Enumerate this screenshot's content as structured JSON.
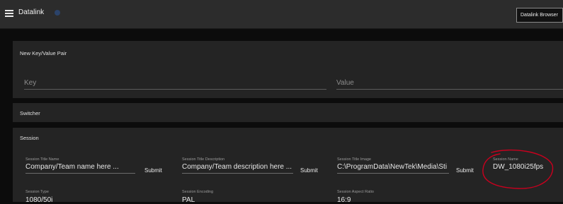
{
  "header": {
    "app_title": "Datalink",
    "browser_button": "Datalink Browser"
  },
  "key_value_panel": {
    "title": "New Key/Value Pair",
    "key_placeholder": "Key",
    "value_placeholder": "Value"
  },
  "switcher_panel": {
    "title": "Switcher"
  },
  "session_panel": {
    "title": "Session",
    "fields": [
      {
        "label": "Session Title Name",
        "value": "Company/Team name here ...",
        "submit": "Submit"
      },
      {
        "label": "Session Title Description",
        "value": "Company/Team description here ...",
        "submit": "Submit"
      },
      {
        "label": "Session Title Image",
        "value": "C:\\ProgramData\\NewTek\\Media\\Sti",
        "submit": "Submit"
      },
      {
        "label": "Session Name",
        "value": "DW_1080i25fps"
      }
    ],
    "info": [
      {
        "label": "Session Type",
        "value": "1080/50i"
      },
      {
        "label": "Session Encoding",
        "value": "PAL"
      },
      {
        "label": "Session Aspect Ratio",
        "value": "16:9"
      }
    ]
  },
  "colors": {
    "top_bar": "#2c2c2c",
    "panel": "#242424",
    "background": "#0c0c0c",
    "annotation": "#c8001e"
  }
}
